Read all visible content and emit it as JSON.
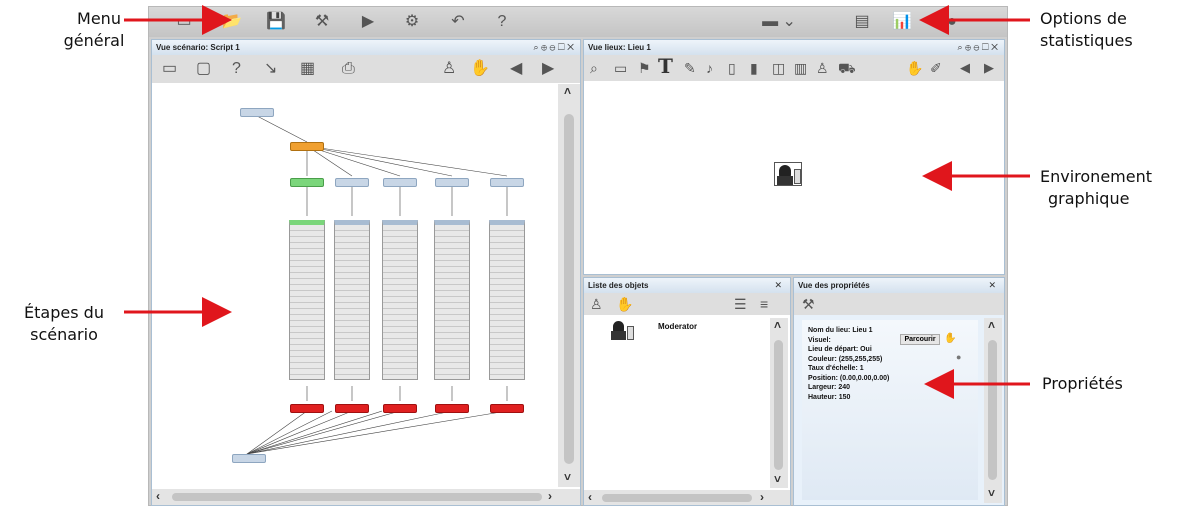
{
  "annotations": {
    "menu": [
      "Menu",
      "général"
    ],
    "stats": [
      "Options de",
      "statistiques"
    ],
    "env": [
      "Environement",
      "graphique"
    ],
    "steps": [
      "Étapes du",
      "scénario"
    ],
    "props": "Propriétés"
  },
  "colors": {
    "arrow": "#e0161c",
    "panel_border": "#a9bfd3",
    "node_green": "#7bd67b",
    "node_red": "#e02020",
    "node_orange": "#f0a030"
  },
  "toolbar": {
    "icons": [
      "folder-icon",
      "open-icon",
      "save-icon",
      "wrench-icon",
      "play-icon",
      "map-icon",
      "undo-icon",
      "help-icon",
      "monitor-icon",
      "chart-icon",
      "stats-icon",
      "info-icon"
    ]
  },
  "scenario_view": {
    "title": "Vue scénario: Script 1"
  },
  "places_view": {
    "title": "Vue lieux: Lieu 1",
    "text_tool": "T"
  },
  "objects_list": {
    "title": "Liste des objets",
    "items": [
      {
        "label": "Moderator"
      }
    ]
  },
  "properties_view": {
    "title": "Vue des propriétés",
    "rows": [
      "Nom du lieu: Lieu 1",
      "Visuel:",
      "Lieu de départ: Oui",
      "Couleur: (255,255,255)",
      "Taux d'échelle: 1",
      "Position: (0.00,0.00,0.00)",
      "Largeur: 240",
      "Hauteur: 150"
    ],
    "browse_button": "Parcourir"
  }
}
